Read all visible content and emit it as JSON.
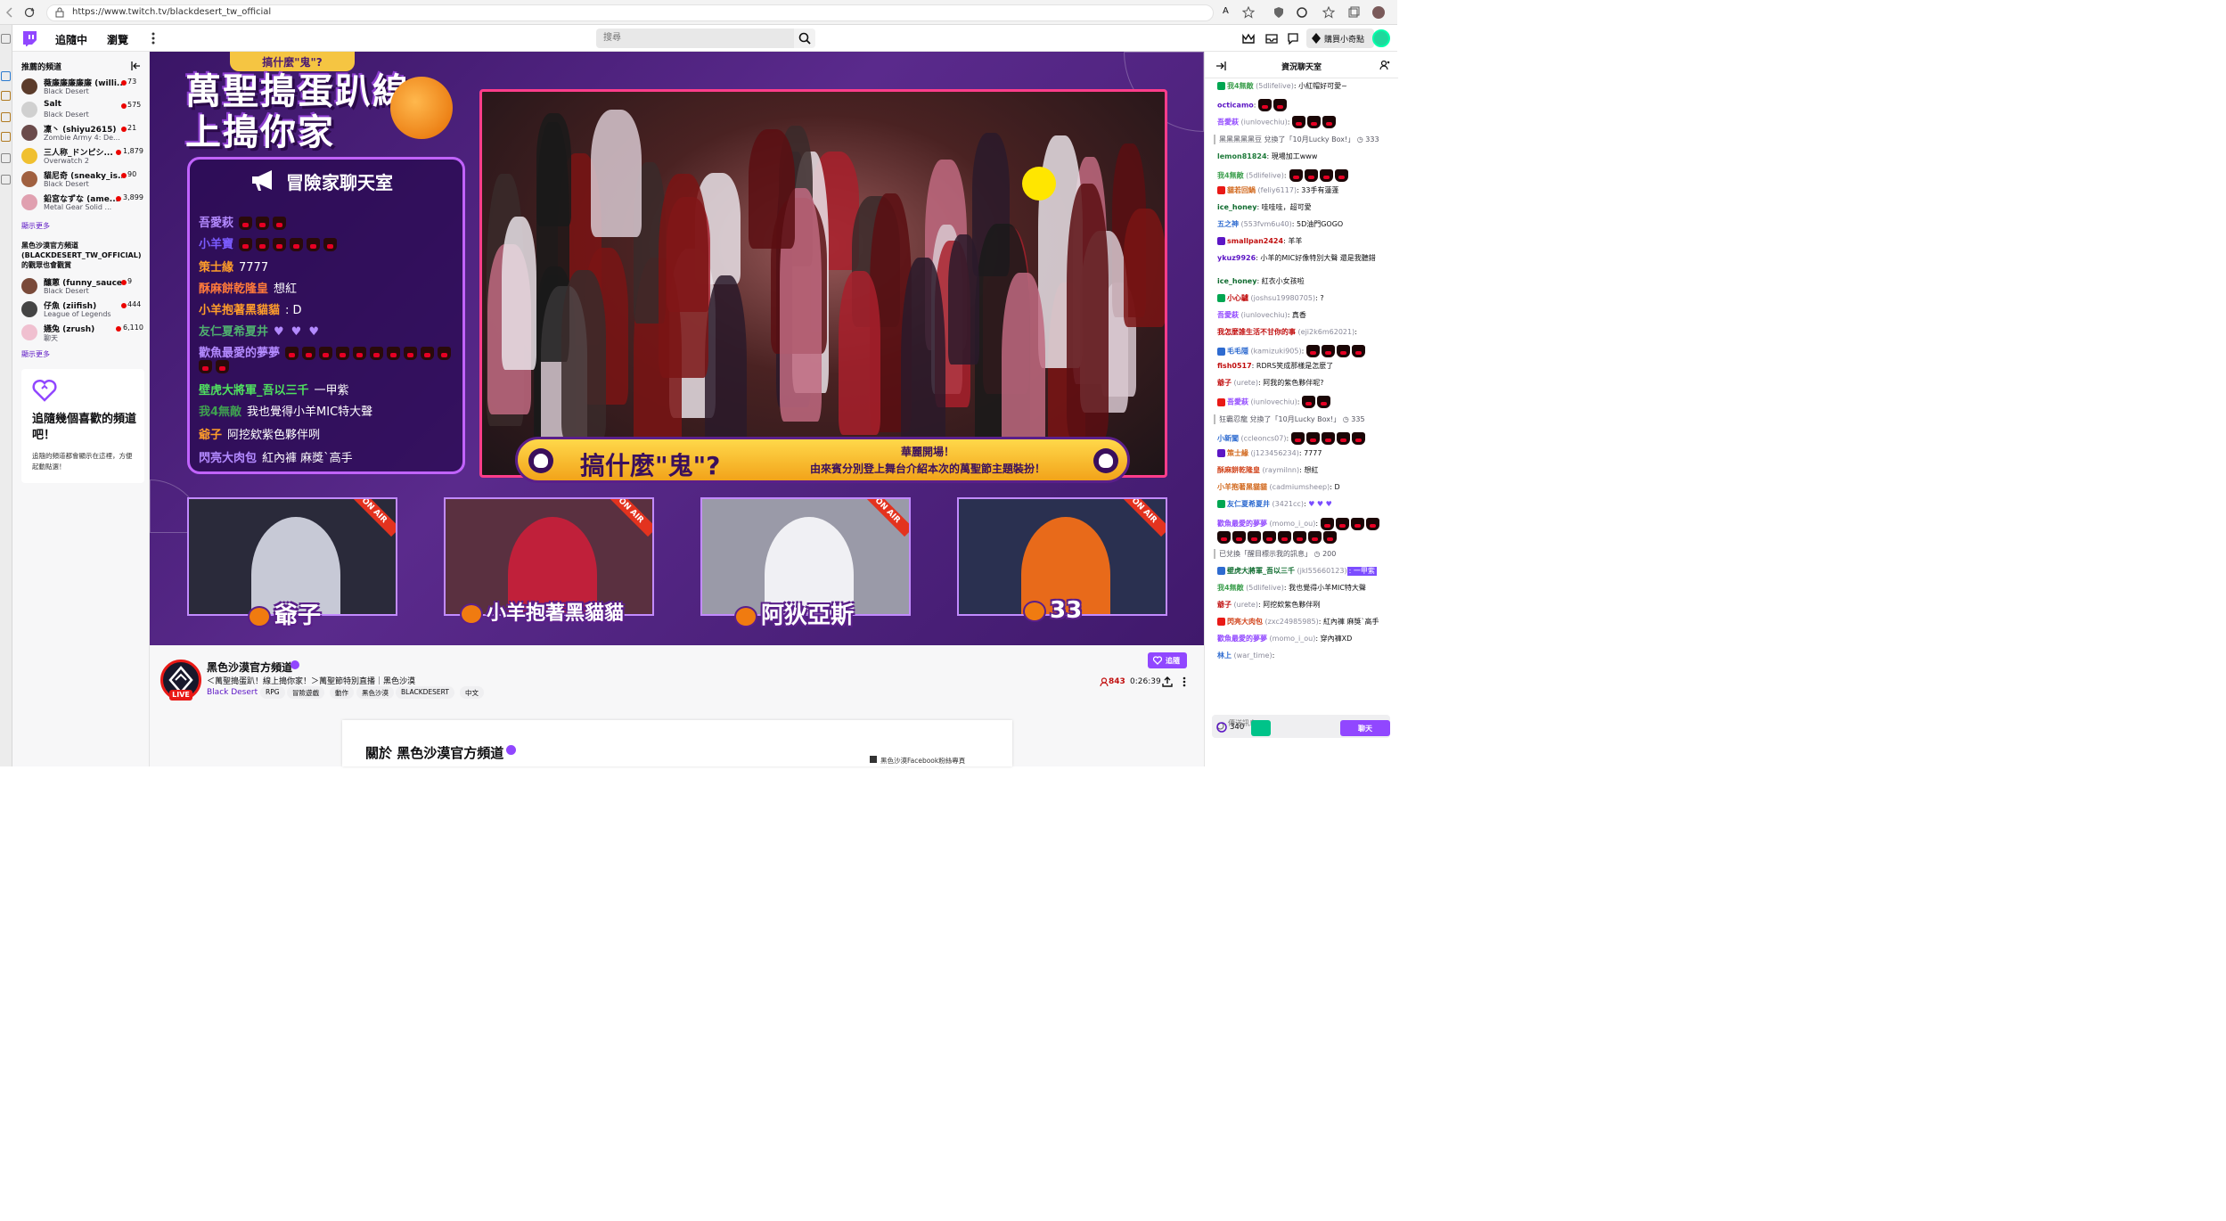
{
  "browser": {
    "url": "https://www.twitch.tv/blackdesert_tw_official",
    "reader_label": "A"
  },
  "topnav": {
    "following": "追隨中",
    "browse": "瀏覽",
    "search_placeholder": "搜尋",
    "bits": "購買小奇點"
  },
  "sidebar": {
    "recommended_title": "推薦的頻道",
    "channels": [
      {
        "name": "薇廉廉廉廉廉 (willi...",
        "game": "Black Desert",
        "viewers": "73",
        "color": "#5b3b2b"
      },
      {
        "name": "Salt",
        "game": "Black Desert",
        "viewers": "575",
        "color": "#d0d0d0"
      },
      {
        "name": "凜丶 (shiyu2615)",
        "game": "Zombie Army 4: De...",
        "viewers": "21",
        "color": "#6b4b4b"
      },
      {
        "name": "三人称_ドンピシ...",
        "game": "Overwatch 2",
        "viewers": "1,879",
        "color": "#f0c030"
      },
      {
        "name": "貓尼奇 (sneaky_is...",
        "game": "Black Desert",
        "viewers": "90",
        "color": "#a06040"
      },
      {
        "name": "鉛宮なずな (ame...",
        "game": "Metal Gear Solid ...",
        "viewers": "3,899",
        "color": "#e0a0b0"
      }
    ],
    "show_more_1": "顯示更多",
    "also_watch_title": "黑色沙漠官方頻道 (BLACKDESERT_TW_OFFICIAL) 的觀眾也會觀賞",
    "also_channels": [
      {
        "name": "釀蔥 (funny_sauce)",
        "game": "Black Desert",
        "viewers": "9",
        "color": "#7a4a3a"
      },
      {
        "name": "仔魚 (ziifish)",
        "game": "League of Legends",
        "viewers": "444",
        "color": "#444"
      },
      {
        "name": "嬿兔 (zrush)",
        "game": "聊天",
        "viewers": "6,110",
        "color": "#f0c0d0"
      }
    ],
    "show_more_2": "顯示更多",
    "card_heading": "追隨幾個喜歡的頻道吧！",
    "card_text": "追隨的頻道都會顯示在這裡，方便起動點選！"
  },
  "video": {
    "banner_tag": "搞什麼\"鬼\"?",
    "event_title": "萬聖搗蛋趴線上搗你家",
    "chat_panel_title": "冒險家聊天室",
    "chat_rows": [
      {
        "user": "吾愛萩",
        "msg": "",
        "color": "#b38aff",
        "emote": "cat",
        "count": 3
      },
      {
        "user": "小羊寶",
        "msg": "",
        "color": "#7b5cff",
        "emote": "cat",
        "count": 6
      },
      {
        "user": "策士緣",
        "msg": "7777",
        "color": "#ff9d2a",
        "emote": "",
        "count": 0
      },
      {
        "user": "酥麻餅乾隆皇",
        "msg": "想紅",
        "color": "#ff7a3a",
        "emote": "",
        "count": 0
      },
      {
        "user": "小羊抱著黑貓貓",
        "msg": ": D",
        "color": "#ff9d2a",
        "emote": "",
        "count": 0
      },
      {
        "user": "友仁夏希夏井",
        "msg": "",
        "color": "#4fb06f",
        "emote": "heart",
        "count": 3
      },
      {
        "user": "歡魚最愛的夢夢",
        "msg": "",
        "color": "#b38aff",
        "emote": "cat",
        "count": 12
      },
      {
        "user": "壁虎大將軍_吾以三千",
        "msg": "一甲紫",
        "color": "#4fe05f",
        "emote": "",
        "count": 0
      },
      {
        "user": "我4無敵",
        "msg": "我也覺得小羊MIC特大聲",
        "color": "#3fa050",
        "emote": "",
        "count": 0
      },
      {
        "user": "爺子",
        "msg": "阿挖欸紫色夥伴咧",
        "color": "#ff9d2a",
        "emote": "",
        "count": 0
      },
      {
        "user": "閃亮大肉包",
        "msg": "紅內褲 麻獎`高手",
        "color": "#b38aff",
        "emote": "",
        "count": 0
      }
    ],
    "scene_banner_left": "搞什麼\"鬼\"?",
    "scene_banner_right1": "華麗開場！",
    "scene_banner_right2": "由來賓分別登上舞台介紹本次的萬聖節主題裝扮！",
    "on_air": "ON AIR",
    "cams": [
      {
        "label": "爺子",
        "bg": "#8a8f9a",
        "person": "#c7c9d6"
      },
      {
        "label": "小羊抱著黑貓貓",
        "bg": "#5a3040",
        "person": "#c0203a"
      },
      {
        "label": "阿狄亞斯",
        "bg": "#9a9aa8",
        "person": "#f0f0f4"
      },
      {
        "label": "33",
        "bg": "#2a3050",
        "person": "#e86a1a"
      }
    ]
  },
  "channel": {
    "name": "黑色沙漠官方頻道",
    "live": "LIVE",
    "title": "＜萬聖搗蛋趴！線上搗你家！＞萬聖節特別直播｜黑色沙漠",
    "game": "Black Desert",
    "tags": [
      "RPG",
      "冒險遊戲",
      "動作",
      "黑色沙漠",
      "BLACKDESERT",
      "中文"
    ],
    "follow": "追隨",
    "viewers": "843",
    "uptime": "0:26:39",
    "about_title": "關於 黑色沙漠官方頻道",
    "fb_link": "黑色沙漠Facebook粉絲專頁"
  },
  "chat": {
    "header": "資況聊天室",
    "messages": [
      {
        "type": "msg",
        "user": "我4無敵",
        "dn": "(5dlifelive)",
        "text": ": 小紅帽好可愛~",
        "color": "#3fa050",
        "emotes": 0
      },
      {
        "type": "msg",
        "user": "octicamo",
        "dn": "",
        "text": ":",
        "color": "#5c16c5",
        "emotes": 2
      },
      {
        "type": "msg",
        "user": "吾愛萩",
        "dn": "(iunlovechiu)",
        "text": ":",
        "color": "#9147ff",
        "emotes": 3
      },
      {
        "type": "sys",
        "text": "黑黑黑黑黑豆 兌換了「10月Lucky Box!」",
        "points": "333"
      },
      {
        "type": "msg",
        "user": "lemon81824",
        "dn": "",
        "text": ": 現場加工www",
        "color": "#1e7a3a",
        "emotes": 0
      },
      {
        "type": "msg",
        "user": "我4無敵",
        "dn": "(5dlifelive)",
        "text": ":",
        "color": "#3fa050",
        "emotes": 4
      },
      {
        "type": "msg",
        "user": "貓若回鍋",
        "dn": "(feliy6117)",
        "text": ": 33手有蓮蓬",
        "color": "#d2691e",
        "emotes": 0
      },
      {
        "type": "msg",
        "user": "ice_honey",
        "dn": "",
        "text": ": 哇哇哇，超可愛",
        "color": "#0e6b2e",
        "emotes": 0
      },
      {
        "type": "msg",
        "user": "五之神",
        "dn": "(553fvm6u40)",
        "text": ": 5D油門GOGO",
        "color": "#2e6bd0",
        "emotes": 0
      },
      {
        "type": "msg",
        "user": "smallpan2424",
        "dn": "",
        "text": ": 羊羊",
        "color": "#c10f0f",
        "emotes": 0
      },
      {
        "type": "msg",
        "user": "ykuz9926",
        "dn": "",
        "text": ": 小羊的MIC好像特別大聲 還是我聽錯",
        "color": "#5c16c5",
        "emotes": 0
      },
      {
        "type": "msg",
        "user": "ice_honey",
        "dn": "",
        "text": ": 紅衣小女孩啦",
        "color": "#0e6b2e",
        "emotes": 0
      },
      {
        "type": "msg",
        "user": "小心驢",
        "dn": "(joshsu19980705)",
        "text": ": ?",
        "color": "#c10f0f",
        "emotes": 0
      },
      {
        "type": "msg",
        "user": "吾愛萩",
        "dn": "(iunlovechiu)",
        "text": ": 真香",
        "color": "#9147ff",
        "emotes": 0
      },
      {
        "type": "msg",
        "user": "我怎麼誰生活不甘你的事",
        "dn": "(eji2k6m62021)",
        "text": ":",
        "color": "#c10f0f",
        "emotes": 0
      },
      {
        "type": "msg",
        "user": "毛毛隱",
        "dn": "(kamizuki905)",
        "text": ":",
        "color": "#2e6bd0",
        "emotes": 4
      },
      {
        "type": "msg",
        "user": "fish0517",
        "dn": "",
        "text": ": RDRS笑成那樣是怎麼了",
        "color": "#c10f0f",
        "emotes": 0
      },
      {
        "type": "msg",
        "user": "爺子",
        "dn": "(urete)",
        "text": ": 阿我的紫色夥伴呢?",
        "color": "#c10f0f",
        "emotes": 0
      },
      {
        "type": "msg",
        "user": "吾愛萩",
        "dn": "(iunlovechiu)",
        "text": ":",
        "color": "#9147ff",
        "emotes": 2
      },
      {
        "type": "sys",
        "text": "狂霸忍龍 兌換了「10月Lucky Box!」",
        "points": "335"
      },
      {
        "type": "msg",
        "user": "小新闖",
        "dn": "(ccleoncs07)",
        "text": ":",
        "color": "#2e6bd0",
        "emotes": 5
      },
      {
        "type": "msg",
        "user": "策士緣",
        "dn": "(j123456234)",
        "text": ": 7777",
        "color": "#d2691e",
        "emotes": 0
      },
      {
        "type": "msg",
        "user": "酥麻餅乾隆皇",
        "dn": "(raymilnn)",
        "text": ": 想紅",
        "color": "#d2461e",
        "emotes": 0
      },
      {
        "type": "msg",
        "user": "小羊抱著黑貓貓",
        "dn": "(cadmiumsheep)",
        "text": ": D",
        "color": "#d2691e",
        "emotes": 0
      },
      {
        "type": "msg",
        "user": "友仁夏希夏井",
        "dn": "(3421cc)",
        "text": ":",
        "color": "#2e6bd0",
        "emotes": 0,
        "hearts": 3
      },
      {
        "type": "msg",
        "user": "歡魚最愛的夢夢",
        "dn": "(momo_i_ou)",
        "text": ":",
        "color": "#9147ff",
        "emotes": 12,
        "tall": true
      },
      {
        "type": "sys",
        "text": "已兌換「醒目標示我的訊息」",
        "points": "200"
      },
      {
        "type": "msg",
        "user": "壁虎大將軍_吾以三千",
        "dn": "(jkl55660123)",
        "text": ": 一甲紫",
        "color": "#0e6b2e",
        "emotes": 0,
        "highlight": true
      },
      {
        "type": "msg",
        "user": "我4無敵",
        "dn": "(5dlifelive)",
        "text": ": 我也覺得小羊MIC特大聲",
        "color": "#3fa050",
        "emotes": 0
      },
      {
        "type": "msg",
        "user": "爺子",
        "dn": "(urete)",
        "text": ": 阿挖欸紫色夥伴咧",
        "color": "#c10f0f",
        "emotes": 0
      },
      {
        "type": "msg",
        "user": "閃亮大肉包",
        "dn": "(zxc24985985)",
        "text": ": 紅內褲 麻獎`高手",
        "color": "#d2461e",
        "emotes": 0
      },
      {
        "type": "msg",
        "user": "歡魚最愛的夢夢",
        "dn": "(momo_i_ou)",
        "text": ": 穿內褲XD",
        "color": "#9147ff",
        "emotes": 0
      },
      {
        "type": "msg",
        "user": "林上",
        "dn": "(war_time)",
        "text": ":",
        "color": "#2e6bd0",
        "emotes": 0
      }
    ],
    "input_placeholder": "傳送訊息",
    "points": "340",
    "send": "聊天"
  }
}
